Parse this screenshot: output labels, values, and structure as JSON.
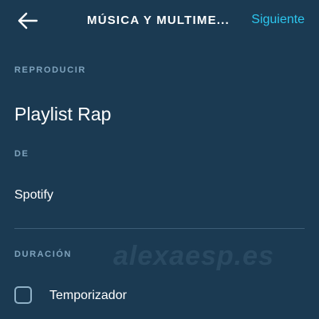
{
  "header": {
    "back_icon": "arrow-left-icon",
    "title": "MÚSICA Y MULTIME...",
    "next_label": "Siguiente",
    "accent_color": "#2cc6ee"
  },
  "sections": {
    "play_label": "REPRODUCIR",
    "play_value": "Playlist Rap",
    "from_label": "DE",
    "from_value": "Spotify",
    "duration_label": "DURACIÓN"
  },
  "timer": {
    "label": "Temporizador",
    "checked": false
  },
  "watermark": "alexaesp.es",
  "colors": {
    "background": "#1b3a52",
    "section_label": "#7fa3bd",
    "divider": "#3d5d76"
  }
}
